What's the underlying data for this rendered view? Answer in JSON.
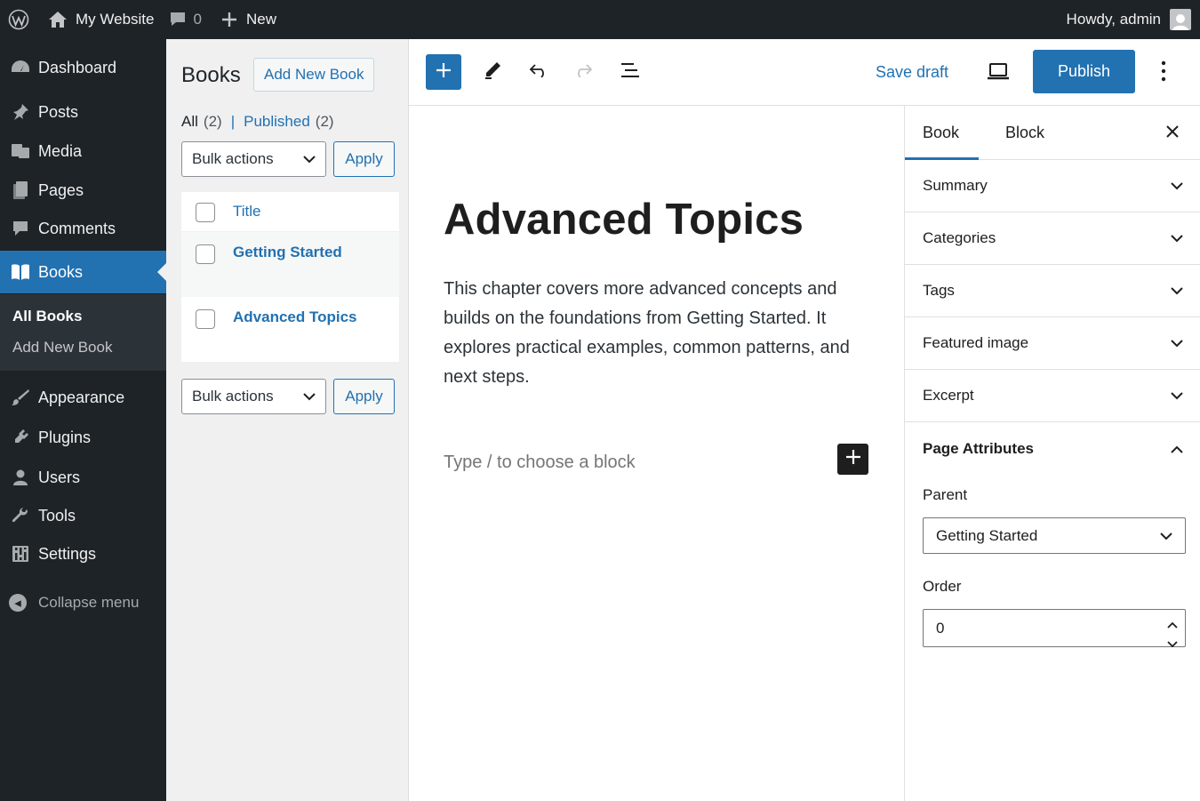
{
  "admin_bar": {
    "site_name": "My Website",
    "comments_count": "0",
    "new_label": "New",
    "greeting": "Howdy, admin"
  },
  "admin_menu": {
    "items": [
      {
        "label": "Dashboard",
        "icon": "dashboard-icon"
      },
      {
        "label": "Posts",
        "icon": "pin-icon"
      },
      {
        "label": "Media",
        "icon": "media-icon"
      },
      {
        "label": "Pages",
        "icon": "pages-icon"
      },
      {
        "label": "Comments",
        "icon": "comment-icon"
      },
      {
        "label": "Books",
        "icon": "book-icon",
        "current": true
      },
      {
        "label": "Appearance",
        "icon": "brush-icon"
      },
      {
        "label": "Plugins",
        "icon": "plugin-icon"
      },
      {
        "label": "Users",
        "icon": "user-icon"
      },
      {
        "label": "Tools",
        "icon": "wrench-icon"
      },
      {
        "label": "Settings",
        "icon": "settings-icon"
      }
    ],
    "submenu": [
      "All Books",
      "Add New Book"
    ],
    "collapse_label": "Collapse menu"
  },
  "list_panel": {
    "title": "Books",
    "add_new": "Add New Book",
    "view_all": "All",
    "view_all_count": "(2)",
    "view_published": "Published",
    "view_published_count": "(2)",
    "bulk_actions": "Bulk actions",
    "apply": "Apply",
    "column_title": "Title",
    "rows": [
      "Getting Started",
      "Advanced Topics"
    ]
  },
  "toolbar": {
    "save_draft": "Save draft",
    "publish": "Publish"
  },
  "editor": {
    "title": "Advanced Topics",
    "paragraph": "This chapter covers more advanced concepts and builds on the foundations from Getting Started. It explores practical examples, common patterns, and next steps.",
    "appender_placeholder": "Type / to choose a block"
  },
  "sidebar": {
    "tabs": [
      "Book",
      "Block"
    ],
    "panels": [
      "Summary",
      "Categories",
      "Tags",
      "Featured image",
      "Excerpt",
      "Page Attributes"
    ],
    "parent_label": "Parent",
    "parent_value": "Getting Started",
    "order_label": "Order",
    "order_value": "0"
  },
  "colors": {
    "admin_dark": "#1d2327",
    "accent": "#2271b1",
    "submenu_bg": "#2c3338"
  }
}
